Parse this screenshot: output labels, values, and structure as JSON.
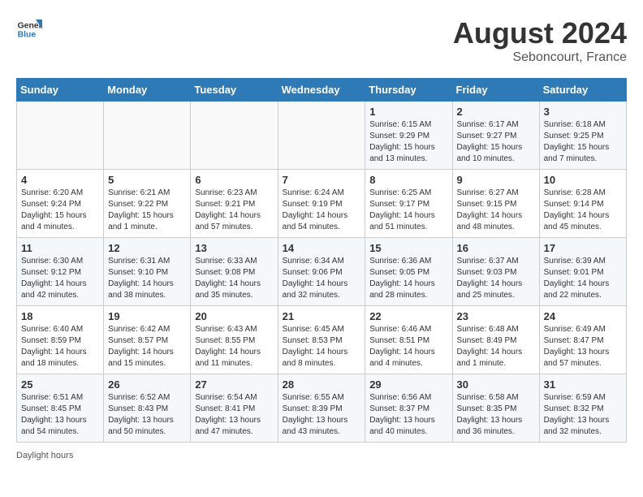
{
  "logo": {
    "line1": "General",
    "line2": "Blue"
  },
  "title": "August 2024",
  "subtitle": "Seboncourt, France",
  "days_of_week": [
    "Sunday",
    "Monday",
    "Tuesday",
    "Wednesday",
    "Thursday",
    "Friday",
    "Saturday"
  ],
  "weeks": [
    [
      {
        "num": "",
        "info": ""
      },
      {
        "num": "",
        "info": ""
      },
      {
        "num": "",
        "info": ""
      },
      {
        "num": "",
        "info": ""
      },
      {
        "num": "1",
        "info": "Sunrise: 6:15 AM\nSunset: 9:29 PM\nDaylight: 15 hours and 13 minutes."
      },
      {
        "num": "2",
        "info": "Sunrise: 6:17 AM\nSunset: 9:27 PM\nDaylight: 15 hours and 10 minutes."
      },
      {
        "num": "3",
        "info": "Sunrise: 6:18 AM\nSunset: 9:25 PM\nDaylight: 15 hours and 7 minutes."
      }
    ],
    [
      {
        "num": "4",
        "info": "Sunrise: 6:20 AM\nSunset: 9:24 PM\nDaylight: 15 hours and 4 minutes."
      },
      {
        "num": "5",
        "info": "Sunrise: 6:21 AM\nSunset: 9:22 PM\nDaylight: 15 hours and 1 minute."
      },
      {
        "num": "6",
        "info": "Sunrise: 6:23 AM\nSunset: 9:21 PM\nDaylight: 14 hours and 57 minutes."
      },
      {
        "num": "7",
        "info": "Sunrise: 6:24 AM\nSunset: 9:19 PM\nDaylight: 14 hours and 54 minutes."
      },
      {
        "num": "8",
        "info": "Sunrise: 6:25 AM\nSunset: 9:17 PM\nDaylight: 14 hours and 51 minutes."
      },
      {
        "num": "9",
        "info": "Sunrise: 6:27 AM\nSunset: 9:15 PM\nDaylight: 14 hours and 48 minutes."
      },
      {
        "num": "10",
        "info": "Sunrise: 6:28 AM\nSunset: 9:14 PM\nDaylight: 14 hours and 45 minutes."
      }
    ],
    [
      {
        "num": "11",
        "info": "Sunrise: 6:30 AM\nSunset: 9:12 PM\nDaylight: 14 hours and 42 minutes."
      },
      {
        "num": "12",
        "info": "Sunrise: 6:31 AM\nSunset: 9:10 PM\nDaylight: 14 hours and 38 minutes."
      },
      {
        "num": "13",
        "info": "Sunrise: 6:33 AM\nSunset: 9:08 PM\nDaylight: 14 hours and 35 minutes."
      },
      {
        "num": "14",
        "info": "Sunrise: 6:34 AM\nSunset: 9:06 PM\nDaylight: 14 hours and 32 minutes."
      },
      {
        "num": "15",
        "info": "Sunrise: 6:36 AM\nSunset: 9:05 PM\nDaylight: 14 hours and 28 minutes."
      },
      {
        "num": "16",
        "info": "Sunrise: 6:37 AM\nSunset: 9:03 PM\nDaylight: 14 hours and 25 minutes."
      },
      {
        "num": "17",
        "info": "Sunrise: 6:39 AM\nSunset: 9:01 PM\nDaylight: 14 hours and 22 minutes."
      }
    ],
    [
      {
        "num": "18",
        "info": "Sunrise: 6:40 AM\nSunset: 8:59 PM\nDaylight: 14 hours and 18 minutes."
      },
      {
        "num": "19",
        "info": "Sunrise: 6:42 AM\nSunset: 8:57 PM\nDaylight: 14 hours and 15 minutes."
      },
      {
        "num": "20",
        "info": "Sunrise: 6:43 AM\nSunset: 8:55 PM\nDaylight: 14 hours and 11 minutes."
      },
      {
        "num": "21",
        "info": "Sunrise: 6:45 AM\nSunset: 8:53 PM\nDaylight: 14 hours and 8 minutes."
      },
      {
        "num": "22",
        "info": "Sunrise: 6:46 AM\nSunset: 8:51 PM\nDaylight: 14 hours and 4 minutes."
      },
      {
        "num": "23",
        "info": "Sunrise: 6:48 AM\nSunset: 8:49 PM\nDaylight: 14 hours and 1 minute."
      },
      {
        "num": "24",
        "info": "Sunrise: 6:49 AM\nSunset: 8:47 PM\nDaylight: 13 hours and 57 minutes."
      }
    ],
    [
      {
        "num": "25",
        "info": "Sunrise: 6:51 AM\nSunset: 8:45 PM\nDaylight: 13 hours and 54 minutes."
      },
      {
        "num": "26",
        "info": "Sunrise: 6:52 AM\nSunset: 8:43 PM\nDaylight: 13 hours and 50 minutes."
      },
      {
        "num": "27",
        "info": "Sunrise: 6:54 AM\nSunset: 8:41 PM\nDaylight: 13 hours and 47 minutes."
      },
      {
        "num": "28",
        "info": "Sunrise: 6:55 AM\nSunset: 8:39 PM\nDaylight: 13 hours and 43 minutes."
      },
      {
        "num": "29",
        "info": "Sunrise: 6:56 AM\nSunset: 8:37 PM\nDaylight: 13 hours and 40 minutes."
      },
      {
        "num": "30",
        "info": "Sunrise: 6:58 AM\nSunset: 8:35 PM\nDaylight: 13 hours and 36 minutes."
      },
      {
        "num": "31",
        "info": "Sunrise: 6:59 AM\nSunset: 8:32 PM\nDaylight: 13 hours and 32 minutes."
      }
    ]
  ],
  "footer": "Daylight hours"
}
